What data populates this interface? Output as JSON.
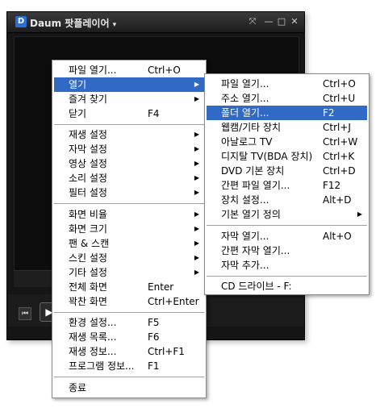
{
  "window": {
    "app_title": "Daum 팟플레이어",
    "dropdown_glyph": "▾",
    "controls": {
      "resize": "⤧",
      "minimize": "—",
      "maximize": "□",
      "close": "✕"
    }
  },
  "player_controls": {
    "prev": "⏮",
    "play": "▶"
  },
  "main_menu": {
    "items": [
      {
        "label": "파일 열기...",
        "shortcut": "Ctrl+O",
        "submenu": false
      },
      {
        "label": "열기",
        "shortcut": "",
        "submenu": true,
        "active": true
      },
      {
        "label": "즐겨 찾기",
        "shortcut": "",
        "submenu": true
      },
      {
        "label": "닫기",
        "shortcut": "F4",
        "submenu": false
      },
      {
        "label": "재생 설정",
        "shortcut": "",
        "submenu": true
      },
      {
        "label": "자막 설정",
        "shortcut": "",
        "submenu": true
      },
      {
        "label": "영상 설정",
        "shortcut": "",
        "submenu": true
      },
      {
        "label": "소리 설정",
        "shortcut": "",
        "submenu": true
      },
      {
        "label": "필터 설정",
        "shortcut": "",
        "submenu": true
      },
      {
        "label": "화면 비율",
        "shortcut": "",
        "submenu": true
      },
      {
        "label": "화면 크기",
        "shortcut": "",
        "submenu": true
      },
      {
        "label": "팬 & 스캔",
        "shortcut": "",
        "submenu": true
      },
      {
        "label": "스킨 설정",
        "shortcut": "",
        "submenu": true
      },
      {
        "label": "기타 설정",
        "shortcut": "",
        "submenu": true
      },
      {
        "label": "전체 화면",
        "shortcut": "Enter",
        "submenu": false
      },
      {
        "label": "꽉찬 화면",
        "shortcut": "Ctrl+Enter",
        "submenu": false
      },
      {
        "label": "환경 설정...",
        "shortcut": "F5",
        "submenu": false
      },
      {
        "label": "재생 목록...",
        "shortcut": "F6",
        "submenu": false
      },
      {
        "label": "재생 정보...",
        "shortcut": "Ctrl+F1",
        "submenu": false
      },
      {
        "label": "프로그램 정보...",
        "shortcut": "F1",
        "submenu": false
      },
      {
        "label": "종료",
        "shortcut": "",
        "submenu": false
      }
    ]
  },
  "open_submenu": {
    "items": [
      {
        "label": "파일 열기...",
        "shortcut": "Ctrl+O",
        "submenu": false
      },
      {
        "label": "주소 열기...",
        "shortcut": "Ctrl+U",
        "submenu": false
      },
      {
        "label": "폴더 열기...",
        "shortcut": "F2",
        "submenu": false,
        "active": true
      },
      {
        "label": "웹캠/기타 장치",
        "shortcut": "Ctrl+J",
        "submenu": false
      },
      {
        "label": "아날로그 TV",
        "shortcut": "Ctrl+W",
        "submenu": false
      },
      {
        "label": "디지탈 TV(BDA 장치)",
        "shortcut": "Ctrl+K",
        "submenu": false
      },
      {
        "label": "DVD 기본 장치",
        "shortcut": "Ctrl+D",
        "submenu": false
      },
      {
        "label": "간편 파일 열기...",
        "shortcut": "F12",
        "submenu": false
      },
      {
        "label": "장치 설정...",
        "shortcut": "Alt+D",
        "submenu": false
      },
      {
        "label": "기본 열기 정의",
        "shortcut": "",
        "submenu": true
      },
      {
        "label": "자막 열기...",
        "shortcut": "Alt+O",
        "submenu": false
      },
      {
        "label": "간편 자막 열기...",
        "shortcut": "",
        "submenu": false
      },
      {
        "label": "자막 추가...",
        "shortcut": "",
        "submenu": false
      },
      {
        "label": "CD 드라이브 - F:",
        "shortcut": "",
        "submenu": false
      }
    ]
  },
  "arrow_glyph": "▶"
}
